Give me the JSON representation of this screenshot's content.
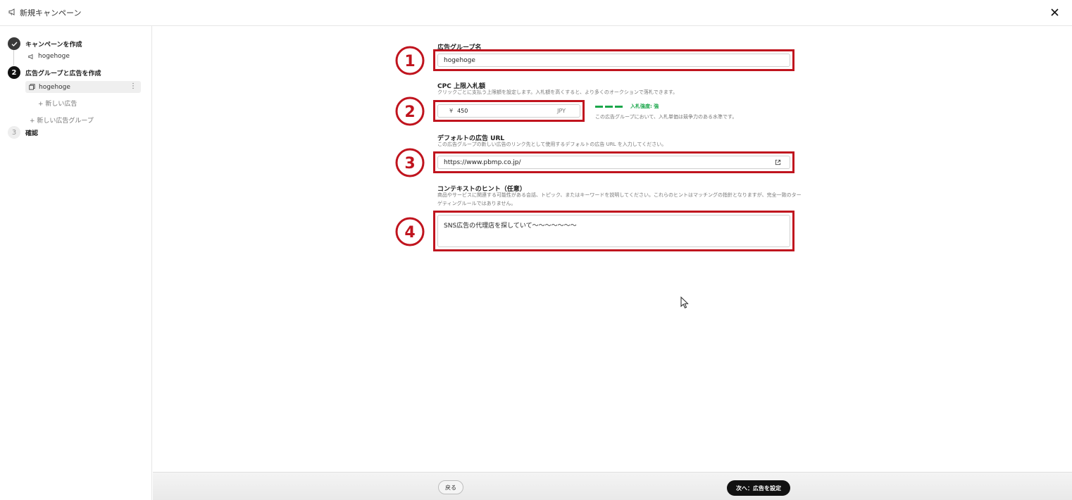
{
  "window": {
    "title": "新規キャンペーン",
    "close_icon": "close-icon"
  },
  "sidebar": {
    "steps": [
      {
        "number": "",
        "label": "キャンペーンを作成",
        "state": "done"
      },
      {
        "number": "2",
        "label": "広告グループと広告を作成",
        "state": "active"
      },
      {
        "number": "3",
        "label": "確認",
        "state": "todo"
      }
    ],
    "campaign_item": "hogehoge",
    "ad_group_item": "hogehoge",
    "new_ad": "+ 新しい広告",
    "new_ad_group": "+ 新しい広告グループ"
  },
  "form": {
    "ad_group_name": {
      "label": "広告グループ名",
      "value": "hogehoge"
    },
    "cpc": {
      "label": "CPC 上限入札額",
      "help": "クリックごとに支払う上限額を設定します。入札額を高くすると、より多くのオークションで落札できます。",
      "currency_symbol": "¥",
      "value": "450",
      "currency": "JPY",
      "strength_label": "入札強度: 強",
      "strength_help": "この広告グループにおいて、入札単価は競争力のある水準です。"
    },
    "default_url": {
      "label": "デフォルトの広告 URL",
      "help": "この広告グループの新しい広告のリンク先として使用するデフォルトの広告 URL を入力してください。",
      "value": "https://www.pbmp.co.jp/"
    },
    "context_hint": {
      "label": "コンテキストのヒント（任意）",
      "help": "商品やサービスに関連する可能性がある会話、トピック、またはキーワードを説明してください。これらのヒントはマッチングの指針となりますが、完全一致のターゲティングルールではありません。",
      "value": "SNS広告の代理店を探していて〜〜〜〜〜〜〜"
    }
  },
  "annotations": [
    "①",
    "②",
    "③",
    "④"
  ],
  "footer": {
    "back_label": "戻る",
    "next_label": "次へ：広告を設定"
  },
  "colors": {
    "highlight": "#c0141e",
    "strength": "#1aa64a",
    "primary_button": "#111111"
  }
}
